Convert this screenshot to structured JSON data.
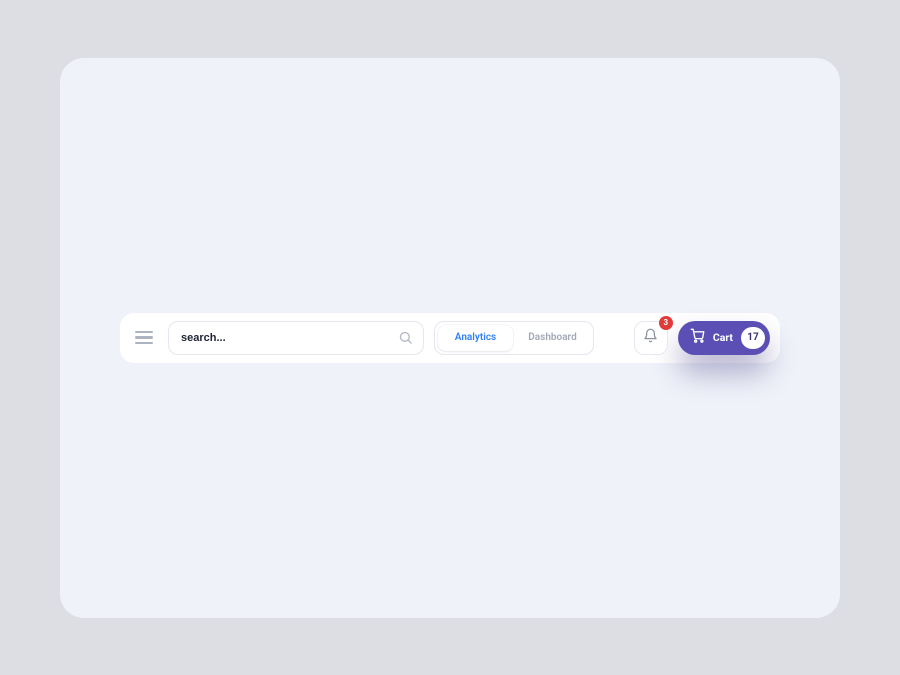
{
  "search": {
    "placeholder": "search..."
  },
  "tabs": {
    "active": "Analytics",
    "inactive": "Dashboard"
  },
  "notifications": {
    "count": "3"
  },
  "cart": {
    "label": "Cart",
    "count": "17"
  },
  "colors": {
    "accent": "#5b4fb6",
    "link": "#2f7ff6",
    "danger": "#e03b3b"
  }
}
